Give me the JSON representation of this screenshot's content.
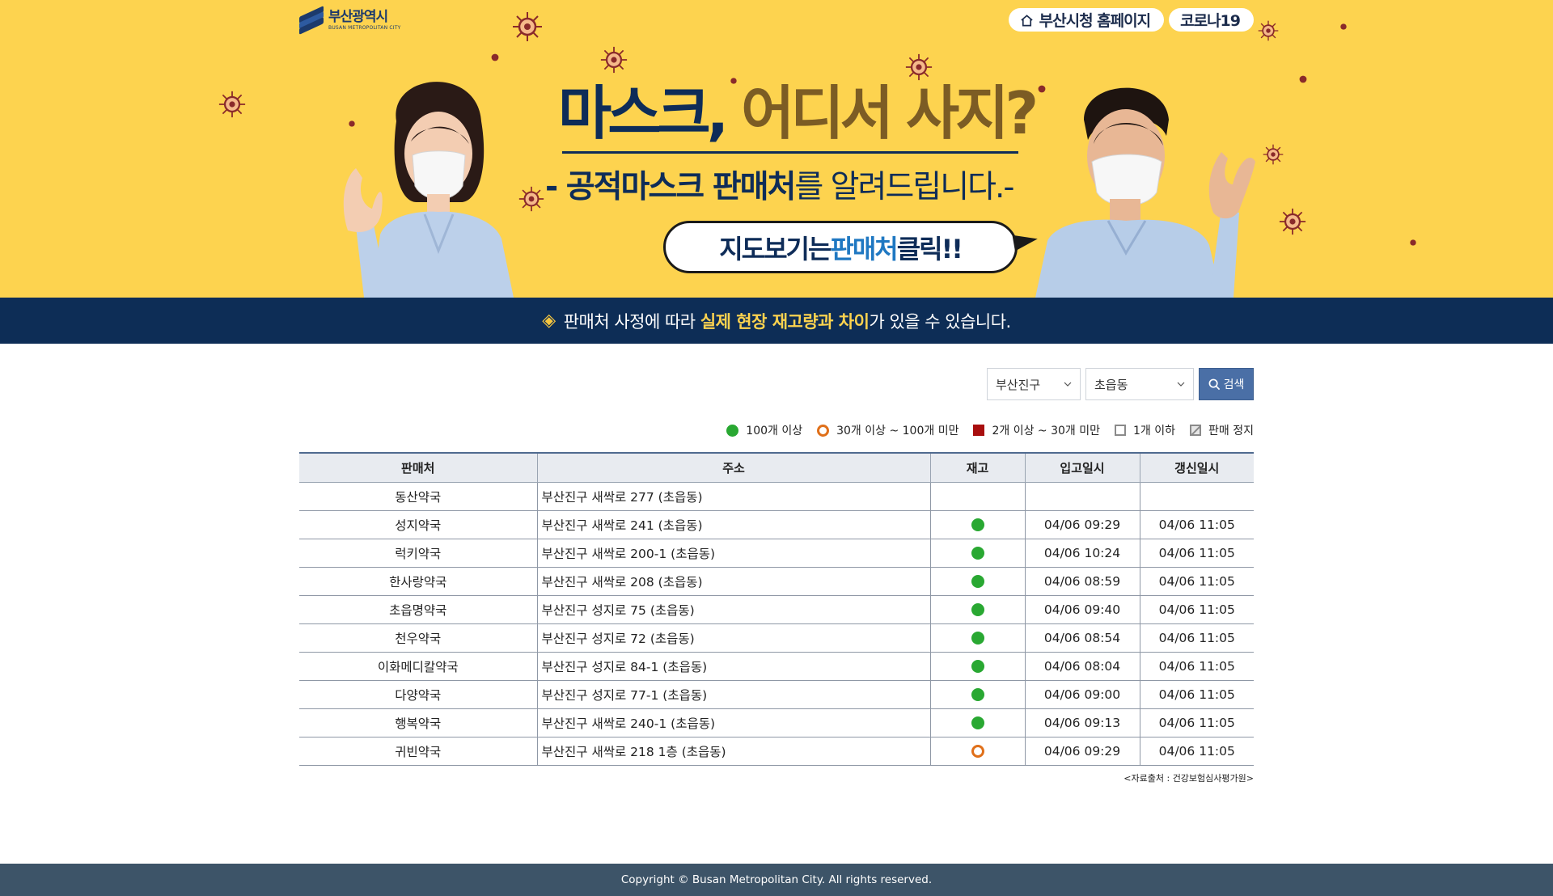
{
  "header": {
    "logo_ko": "부산광역시",
    "logo_en": "BUSAN METROPOLITAN CITY",
    "links": [
      {
        "label": "부산시청 홈페이지",
        "icon": "home-icon"
      },
      {
        "label": "코로나19"
      }
    ]
  },
  "banner": {
    "title_part1": "마스크,",
    "title_part2": "어디서 사지?",
    "subtitle_prefix": "- 공적마스크 판매처",
    "subtitle_suffix": "를 알려드립니다.-",
    "bubble_prefix": "지도보기는 ",
    "bubble_highlight": "판매처",
    "bubble_suffix": " 클릭!!"
  },
  "notice": {
    "icon": "diamond-icon",
    "prefix": "판매처 사정에 따라 ",
    "bold": "실제 현장 재고량과 차이",
    "suffix": "가 있을 수 있습니다."
  },
  "search": {
    "district": "부산진구",
    "dong": "초읍동",
    "button_label": "검색",
    "button_icon": "search-icon"
  },
  "legend": [
    {
      "label": "100개 이상",
      "icon": "green-dot"
    },
    {
      "label": "30개 이상 ~ 100개 미만",
      "icon": "orange-ring"
    },
    {
      "label": "2개 이상 ~ 30개 미만",
      "icon": "red-square"
    },
    {
      "label": "1개 이하",
      "icon": "gray-square"
    },
    {
      "label": "판매 정지",
      "icon": "stopped-square"
    }
  ],
  "table": {
    "headers": [
      "판매처",
      "주소",
      "재고",
      "입고일시",
      "갱신일시"
    ],
    "rows": [
      {
        "name": "동산약국",
        "addr": "부산진구 새싹로 277 (초읍동)",
        "stock": "",
        "in": "",
        "up": ""
      },
      {
        "name": "성지약국",
        "addr": "부산진구 새싹로 241 (초읍동)",
        "stock": "green",
        "in": "04/06 09:29",
        "up": "04/06 11:05"
      },
      {
        "name": "럭키약국",
        "addr": "부산진구 새싹로 200-1 (초읍동)",
        "stock": "green",
        "in": "04/06 10:24",
        "up": "04/06 11:05"
      },
      {
        "name": "한사랑약국",
        "addr": "부산진구 새싹로 208 (초읍동)",
        "stock": "green",
        "in": "04/06 08:59",
        "up": "04/06 11:05"
      },
      {
        "name": "초읍명약국",
        "addr": "부산진구 성지로 75 (초읍동)",
        "stock": "green",
        "in": "04/06 09:40",
        "up": "04/06 11:05"
      },
      {
        "name": "천우약국",
        "addr": "부산진구 성지로 72 (초읍동)",
        "stock": "green",
        "in": "04/06 08:54",
        "up": "04/06 11:05"
      },
      {
        "name": "이화메디칼약국",
        "addr": "부산진구 성지로 84-1 (초읍동)",
        "stock": "green",
        "in": "04/06 08:04",
        "up": "04/06 11:05"
      },
      {
        "name": "다양약국",
        "addr": "부산진구 성지로 77-1 (초읍동)",
        "stock": "green",
        "in": "04/06 09:00",
        "up": "04/06 11:05"
      },
      {
        "name": "행복약국",
        "addr": "부산진구 새싹로 240-1 (초읍동)",
        "stock": "green",
        "in": "04/06 09:13",
        "up": "04/06 11:05"
      },
      {
        "name": "귀빈약국",
        "addr": "부산진구 새싹로 218 1층 (초읍동)",
        "stock": "orange",
        "in": "04/06 09:29",
        "up": "04/06 11:05"
      }
    ]
  },
  "source": "<자료출처 : 건강보험심사평가원>",
  "footer": "Copyright © Busan Metropolitan City. All rights reserved.",
  "colors": {
    "banner_bg": "#fdd34f",
    "notice_bg": "#0d2d56",
    "footer_bg": "#3d5468",
    "stock_green": "#29a832",
    "stock_orange": "#e0701a"
  }
}
